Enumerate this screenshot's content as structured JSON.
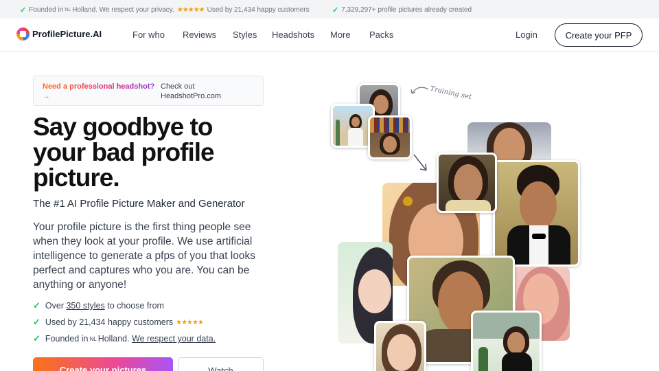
{
  "topbar": {
    "item1_prefix": "Founded in",
    "item1_flag": "NL",
    "item1_mid": "Holland. We respect your privacy.",
    "item1_stars": "★★★★★",
    "item1_suffix": "Used by 21,434 happy customers",
    "item2": "7,329,297+ profile pictures already created"
  },
  "nav": {
    "logo": "ProfilePicture.AI",
    "links": [
      "For who",
      "Reviews",
      "Styles",
      "Headshots",
      "More",
      "Packs"
    ],
    "login": "Login",
    "cta": "Create your PFP"
  },
  "promo": {
    "left": "Need a professional headshot? →",
    "right": "Check out HeadshotPro.com"
  },
  "hero": {
    "title": "Say goodbye to your bad profile picture.",
    "subtitle": "The #1 AI Profile Picture Maker and Generator",
    "description": "Your profile picture is the first thing people see when they look at your profile. We use artificial intelligence to generate a pfps of you that looks perfect and captures who you are. You can be anything or anyone!"
  },
  "features": {
    "f1_prefix": "Over",
    "f1_link": "350 styles",
    "f1_suffix": "to choose from",
    "f2": "Used by 21,434 happy customers",
    "f2_stars": "★★★★★",
    "f3_prefix": "Founded in",
    "f3_flag": "NL",
    "f3_mid": "Holland.",
    "f3_link": "We respect your data."
  },
  "buttons": {
    "create": "Create your pictures",
    "watch": "Watch"
  },
  "collage": {
    "annotation": "Training set"
  },
  "colors": {
    "accent_gradient_start": "#f97316",
    "accent_gradient_mid": "#ec4899",
    "accent_gradient_end": "#a855f7",
    "check": "#22c55e",
    "stars": "#f59e0b"
  }
}
